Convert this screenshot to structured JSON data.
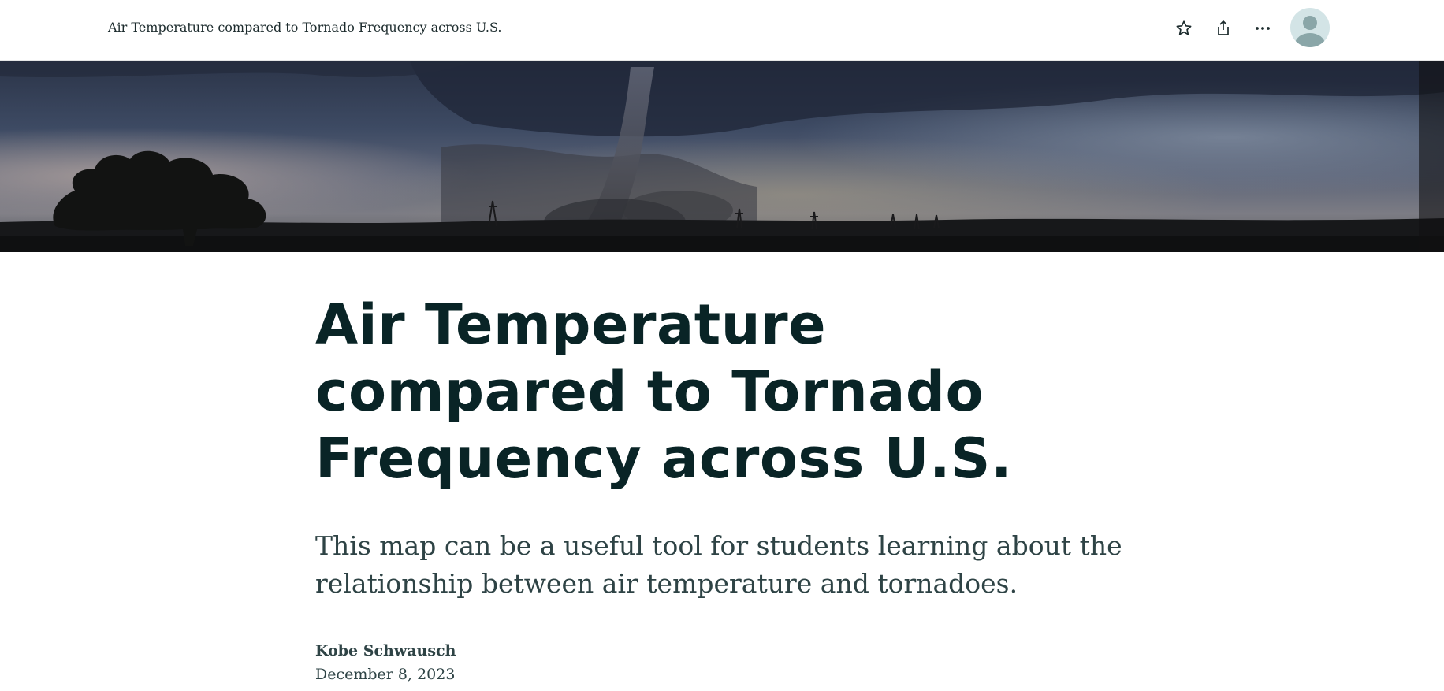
{
  "header": {
    "title": "Air Temperature compared to Tornado Frequency across U.S.",
    "icons": [
      "star-icon",
      "share-icon",
      "more-icon",
      "user-avatar-icon"
    ]
  },
  "hero": {
    "image_subject": "tornado-landscape"
  },
  "article": {
    "title": "Air Temperature compared to Tornado Frequency across U.S.",
    "subtitle": "This map can be a useful tool for students learning about the relationship between air temperature and tornadoes.",
    "author": "Kobe Schwausch",
    "date": "December 8, 2023"
  },
  "colors": {
    "title": "#092426",
    "body_text": "#2e4345",
    "avatar_bg": "#d3e4e6",
    "avatar_fg": "#8aa6a8"
  }
}
